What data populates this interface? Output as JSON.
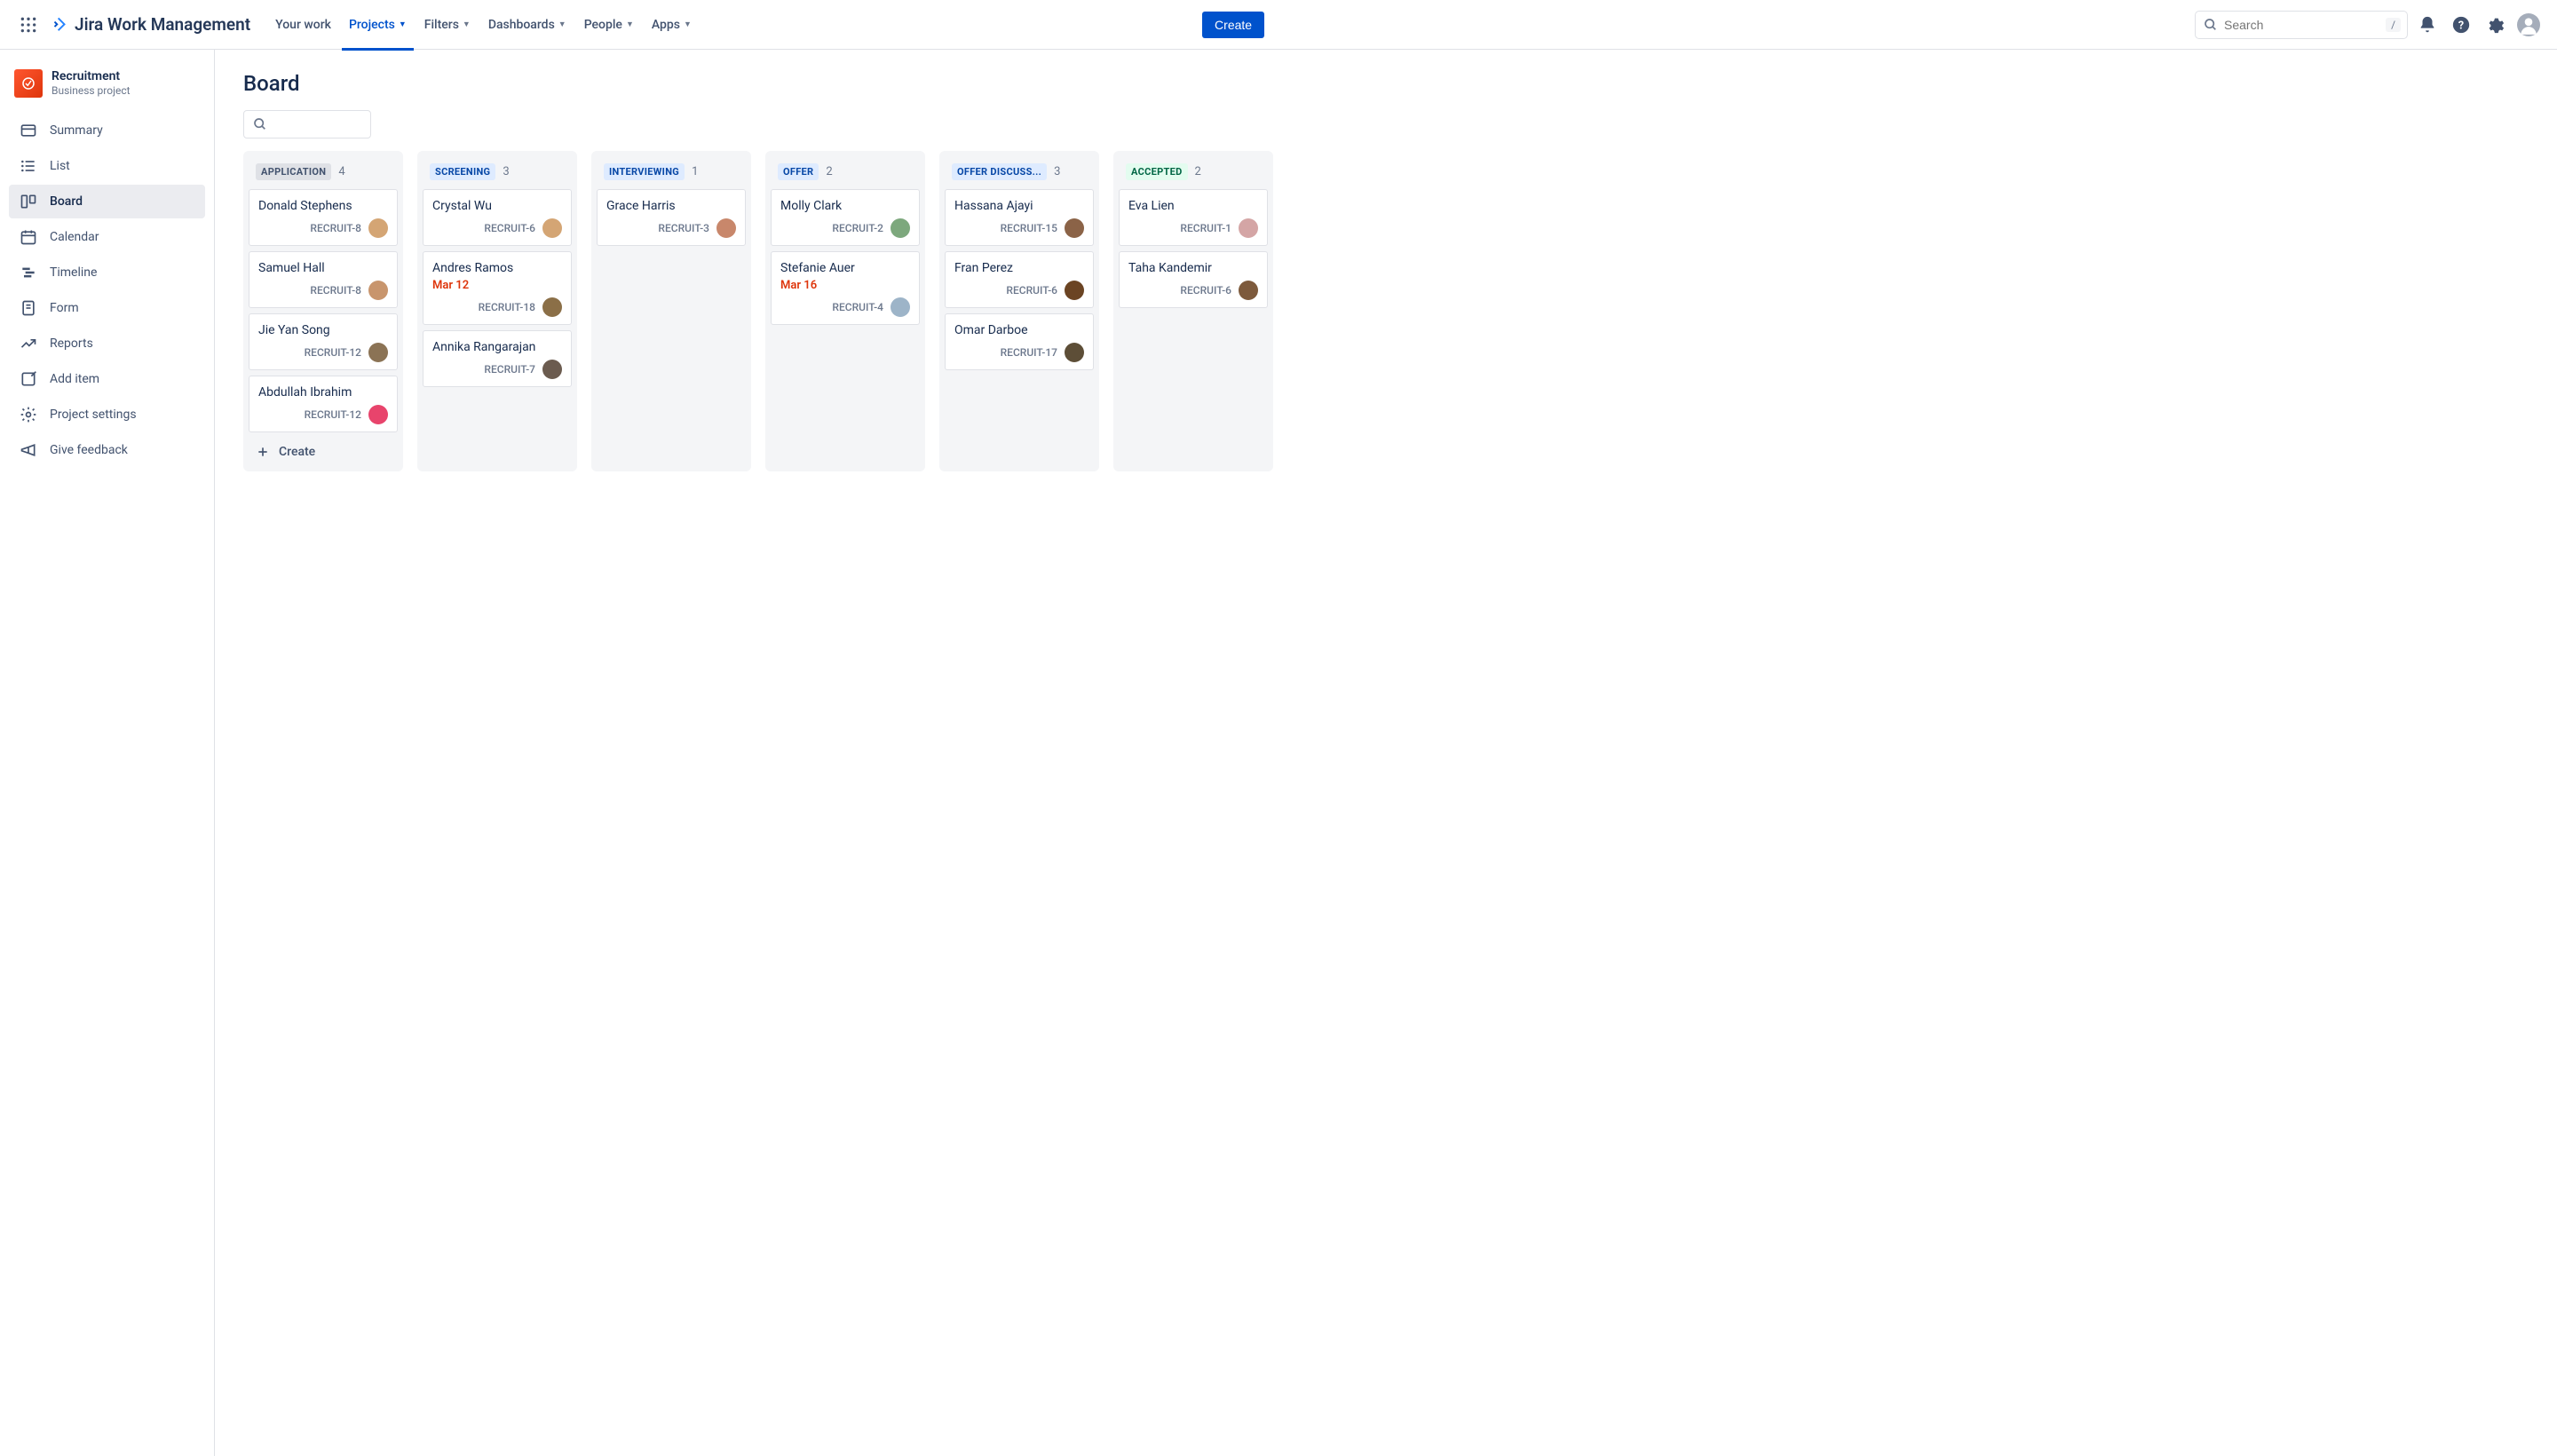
{
  "header": {
    "product_name": "Jira Work Management",
    "nav": [
      {
        "label": "Your work",
        "dropdown": false
      },
      {
        "label": "Projects",
        "dropdown": true,
        "active": true
      },
      {
        "label": "Filters",
        "dropdown": true
      },
      {
        "label": "Dashboards",
        "dropdown": true
      },
      {
        "label": "People",
        "dropdown": true
      },
      {
        "label": "Apps",
        "dropdown": true
      }
    ],
    "create_label": "Create",
    "search_placeholder": "Search",
    "search_shortcut": "/"
  },
  "sidebar": {
    "project_name": "Recruitment",
    "project_type": "Business project",
    "items": [
      {
        "label": "Summary",
        "icon": "card-icon"
      },
      {
        "label": "List",
        "icon": "list-icon"
      },
      {
        "label": "Board",
        "icon": "board-icon",
        "active": true
      },
      {
        "label": "Calendar",
        "icon": "calendar-icon"
      },
      {
        "label": "Timeline",
        "icon": "timeline-icon"
      },
      {
        "label": "Form",
        "icon": "form-icon"
      },
      {
        "label": "Reports",
        "icon": "reports-icon"
      },
      {
        "label": "Add item",
        "icon": "add-item-icon"
      },
      {
        "label": "Project settings",
        "icon": "settings-icon"
      },
      {
        "label": "Give feedback",
        "icon": "feedback-icon"
      }
    ]
  },
  "board": {
    "title": "Board",
    "create_label": "Create",
    "columns": [
      {
        "name": "APPLICATION",
        "count": 4,
        "badge_class": "badge-gray",
        "cards": [
          {
            "title": "Donald Stephens",
            "key": "RECRUIT-8",
            "avatar": "#D4A574"
          },
          {
            "title": "Samuel Hall",
            "key": "RECRUIT-8",
            "avatar": "#C8956D"
          },
          {
            "title": "Jie Yan Song",
            "key": "RECRUIT-12",
            "avatar": "#8B7355"
          },
          {
            "title": "Abdullah Ibrahim",
            "key": "RECRUIT-12",
            "avatar": "#E8446C"
          }
        ]
      },
      {
        "name": "SCREENING",
        "count": 3,
        "badge_class": "badge-blue",
        "cards": [
          {
            "title": "Crystal Wu",
            "key": "RECRUIT-6",
            "avatar": "#D4A574"
          },
          {
            "title": "Andres Ramos",
            "key": "RECRUIT-18",
            "date": "Mar 12",
            "avatar": "#8B6F47"
          },
          {
            "title": "Annika Rangarajan",
            "key": "RECRUIT-7",
            "avatar": "#6B5B4F"
          }
        ]
      },
      {
        "name": "INTERVIEWING",
        "count": 1,
        "badge_class": "badge-blue",
        "cards": [
          {
            "title": "Grace Harris",
            "key": "RECRUIT-3",
            "avatar": "#C8876B"
          }
        ]
      },
      {
        "name": "OFFER",
        "count": 2,
        "badge_class": "badge-blue",
        "cards": [
          {
            "title": "Molly Clark",
            "key": "RECRUIT-2",
            "avatar": "#7DA87D"
          },
          {
            "title": "Stefanie Auer",
            "key": "RECRUIT-4",
            "date": "Mar 16",
            "avatar": "#9DB4C8"
          }
        ]
      },
      {
        "name": "OFFER DISCUSS...",
        "count": 3,
        "badge_class": "badge-blue",
        "cards": [
          {
            "title": "Hassana Ajayi",
            "key": "RECRUIT-15",
            "avatar": "#8B6347"
          },
          {
            "title": "Fran Perez",
            "key": "RECRUIT-6",
            "avatar": "#6B4423"
          },
          {
            "title": "Omar Darboe",
            "key": "RECRUIT-17",
            "avatar": "#5D4E37"
          }
        ]
      },
      {
        "name": "ACCEPTED",
        "count": 2,
        "badge_class": "badge-green",
        "cards": [
          {
            "title": "Eva Lien",
            "key": "RECRUIT-1",
            "avatar": "#D4A5A5"
          },
          {
            "title": "Taha Kandemir",
            "key": "RECRUIT-6",
            "avatar": "#7D5A3C"
          }
        ]
      }
    ]
  }
}
